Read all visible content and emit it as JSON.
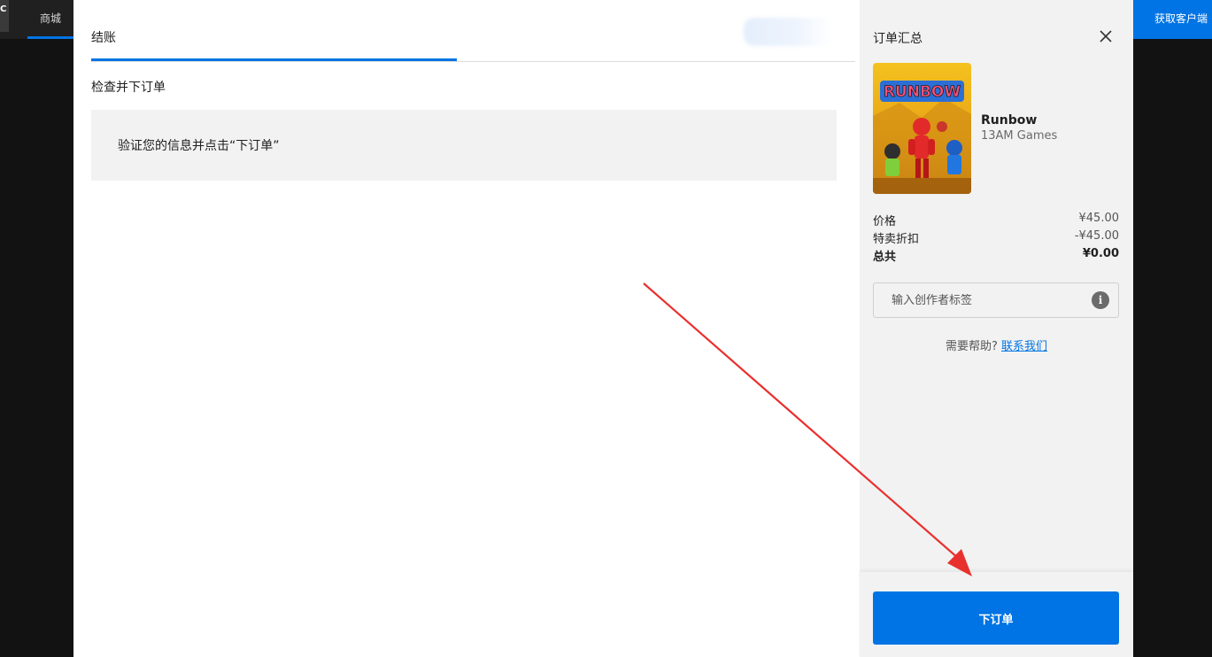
{
  "background_nav": {
    "logo_text": "C",
    "store_label": "商城",
    "get_client_label": "获取客户端"
  },
  "checkout": {
    "tab_label": "结账",
    "section_title": "检查并下订单",
    "info_message": "验证您的信息并点击“下订单”"
  },
  "summary": {
    "title": "订单汇总",
    "product": {
      "cover_title": "RUNBOW",
      "name": "Runbow",
      "developer": "13AM Games"
    },
    "price_label": "价格",
    "price_value": "¥45.00",
    "discount_label": "特卖折扣",
    "discount_value": "-¥45.00",
    "total_label": "总共",
    "total_value": "¥0.00",
    "creator_tag_placeholder": "输入创作者标签",
    "help_text": "需要帮助?",
    "help_link": "联系我们",
    "place_order_label": "下订单"
  },
  "colors": {
    "accent": "#0074e4",
    "annotation_arrow": "#e8312f"
  },
  "icons": [
    "close-icon",
    "info-icon",
    "annotation-arrow"
  ]
}
